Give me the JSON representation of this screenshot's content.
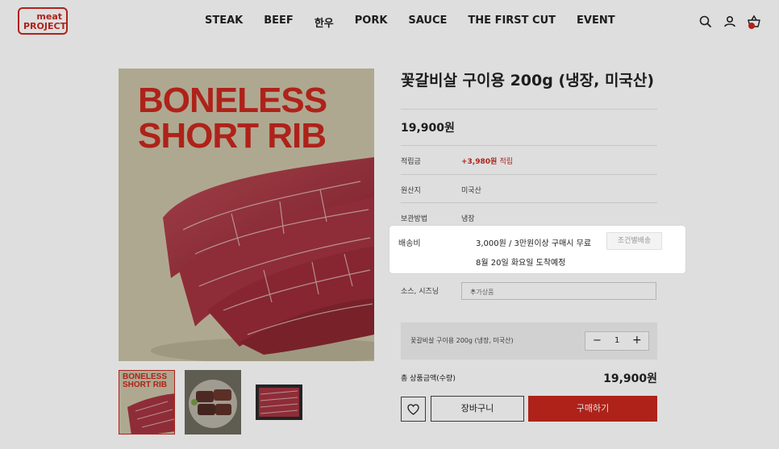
{
  "header": {
    "logo_line1": "meat",
    "logo_line2": "PROJECT",
    "nav": [
      "STEAK",
      "BEEF",
      "한우",
      "PORK",
      "SAUCE",
      "THE FIRST CUT",
      "EVENT"
    ],
    "cart_count": "0",
    "icons": [
      "search-icon",
      "user-icon",
      "cart-icon"
    ]
  },
  "gallery": {
    "main_image_text_line1": "BONELESS",
    "main_image_text_line2": "SHORT RIB",
    "thumb1_text_line1": "BONELESS",
    "thumb1_text_line2": "SHORT RIB"
  },
  "product": {
    "title": "꽃갈비살 구이용 200g (냉장, 미국산)",
    "price": "19,900원",
    "points_label": "적립금",
    "points_value": "+3,980원",
    "points_suffix": "적립",
    "origin_label": "원산지",
    "origin_value": "미국산",
    "storage_label": "보관방법",
    "storage_value": "냉장",
    "sauce_label": "소스, 시즈닝",
    "sauce_placeholder": "추가상품",
    "option_name": "꽃갈비살 구이용 200g (냉장, 미국산)",
    "quantity": "1",
    "total_label": "총 상품금액(수량)",
    "total_value": "19,900원",
    "cart_button": "장바구니",
    "buy_button": "구매하기"
  },
  "shipping_popup": {
    "label": "배송비",
    "line1": "3,000원  / 3만원이상 구매시 무료",
    "line2": "8월 20일 화요일 도착예정",
    "button": "조건별배송"
  },
  "colors": {
    "brand_red": "#c8281e",
    "image_bg": "#c9c2a6"
  }
}
